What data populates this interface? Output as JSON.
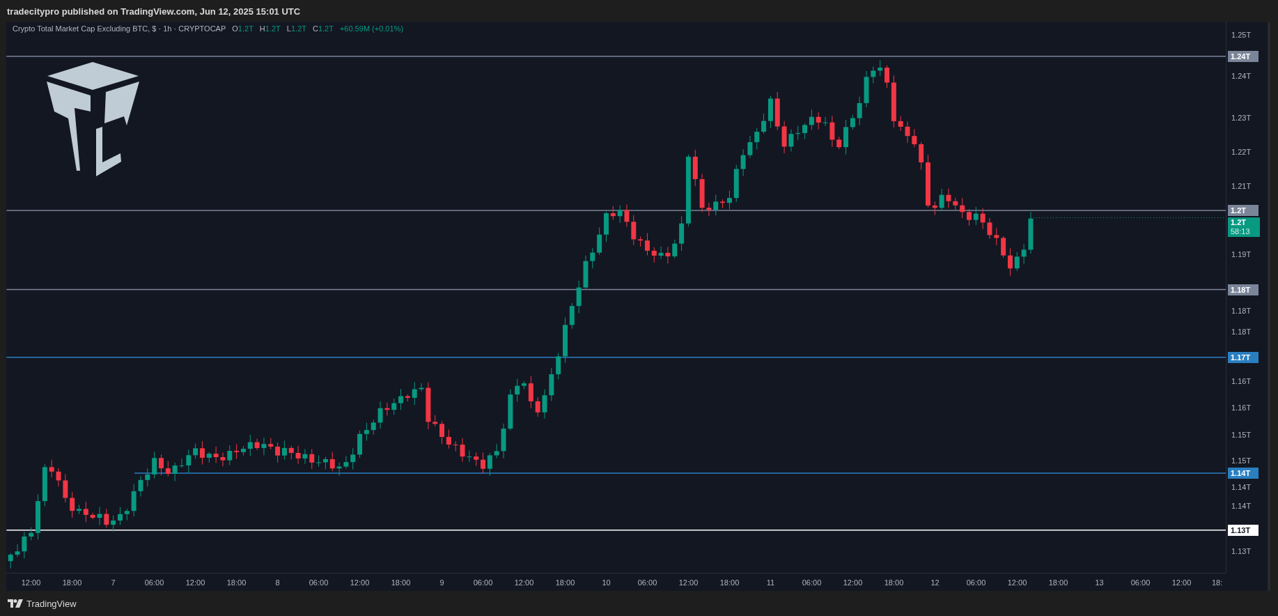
{
  "publish_note": "tradecitypro published on TradingView.com, Jun 12, 2025 15:01 UTC",
  "chart": {
    "legend": {
      "title": "Crypto Total Market Cap Excluding BTC, $ · 1h · CRYPTOCAP",
      "ohlc": [
        {
          "key": "O",
          "value": "1.2T"
        },
        {
          "key": "H",
          "value": "1.2T"
        },
        {
          "key": "L",
          "value": "1.2T"
        },
        {
          "key": "C",
          "value": "1.2T"
        }
      ],
      "change": "+60.59M (+0.01%)"
    },
    "price_ticks": [
      "1.25T",
      "1.24T",
      "1.23T",
      "1.22T",
      "1.21T",
      "1.19T",
      "1.18T",
      "1.18T",
      "1.16T",
      "1.16T",
      "1.15T",
      "1.15T",
      "1.14T",
      "1.14T",
      "1.13T"
    ],
    "levels": [
      {
        "label": "1.24T",
        "color": "#7b8599"
      },
      {
        "label": "1.2T",
        "color": "#7b8599"
      },
      {
        "label": "1.18T",
        "color": "#7b8599"
      },
      {
        "label": "1.17T",
        "color": "#2a7fc1"
      },
      {
        "label": "1.14T",
        "color": "#2a7fc1"
      },
      {
        "label": "1.13T",
        "color": "#ffffff"
      }
    ],
    "last_price": {
      "price": "1.2T",
      "countdown": "58:13"
    },
    "time_ticks": [
      "12:00",
      "18:00",
      "7",
      "06:00",
      "12:00",
      "18:00",
      "8",
      "06:00",
      "12:00",
      "18:00",
      "9",
      "06:00",
      "12:00",
      "18:00",
      "10",
      "06:00",
      "12:00",
      "18:00",
      "11",
      "06:00",
      "12:00",
      "18:00",
      "12",
      "06:00",
      "12:00",
      "18:00",
      "13",
      "06:00",
      "12:00",
      "18:"
    ]
  },
  "footer": {
    "brand": "TradingView"
  }
}
